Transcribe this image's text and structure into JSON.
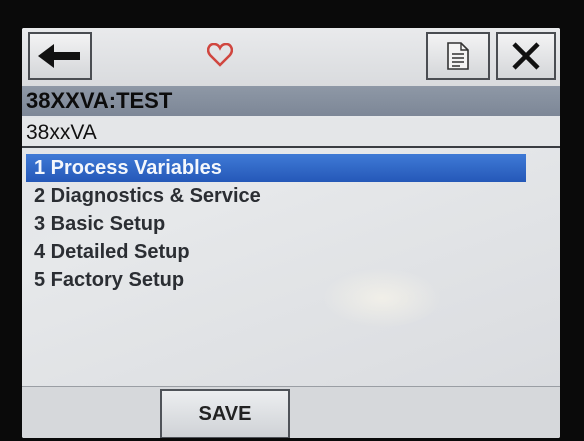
{
  "toolbar": {
    "back_icon": "arrow-left-icon",
    "status_icon": "heart-icon",
    "status_color": "#d0463f",
    "document_icon": "document-icon",
    "close_icon": "close-icon"
  },
  "device": {
    "tag": "38XXVA:TEST",
    "model": "38xxVA"
  },
  "menu": {
    "selected_index": 0,
    "selected_color": "#2f67c8",
    "items": [
      {
        "label": "1 Process Variables"
      },
      {
        "label": "2 Diagnostics & Service"
      },
      {
        "label": "3 Basic Setup"
      },
      {
        "label": "4 Detailed Setup"
      },
      {
        "label": "5 Factory Setup"
      }
    ]
  },
  "footer": {
    "save_label": "SAVE"
  }
}
